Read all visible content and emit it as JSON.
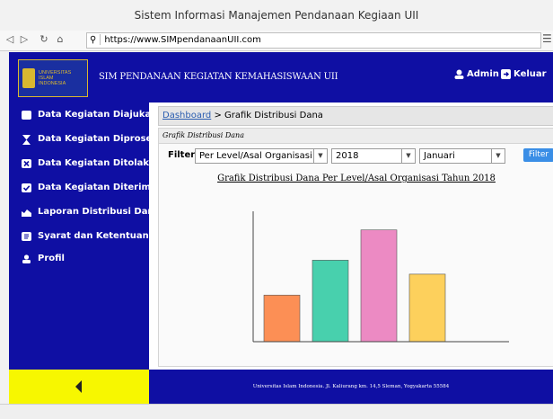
{
  "window": {
    "title": "Sistem Informasi Manajemen Pendanaan Kegiaan UII"
  },
  "browser": {
    "url": "https://www.SIMpendanaanUII.com",
    "nav_icons": [
      "back-icon",
      "forward-icon",
      "refresh-icon",
      "home-icon",
      "search-icon",
      "menu-icon"
    ]
  },
  "header": {
    "logo_lines": [
      "UNIVERSITAS",
      "ISLAM",
      "INDONESIA"
    ],
    "site_name": "SIM PENDANAAN KEGIATAN KEMAHASISWAAN UII",
    "admin_label": "Admin",
    "logout_label": "Keluar"
  },
  "sidebar": {
    "items": [
      {
        "label": "Data Kegiatan Diajukan",
        "icon": "folder-open-icon"
      },
      {
        "label": "Data Kegiatan Diproses",
        "icon": "hourglass-icon"
      },
      {
        "label": "Data Kegiatan Ditolak",
        "icon": "x-box-icon"
      },
      {
        "label": "Data Kegiatan Diterima",
        "icon": "checkbox-icon"
      },
      {
        "label": "Laporan Distribusi Dana",
        "icon": "area-chart-icon"
      },
      {
        "label": "Syarat dan Ketentuan",
        "icon": "document-icon"
      },
      {
        "label": "Profil",
        "icon": "user-icon"
      }
    ]
  },
  "breadcrumb": {
    "home": "Dashboard",
    "separator": " > ",
    "current": "Grafik Distribusi Dana"
  },
  "panel": {
    "title": "Grafik Distribusi Dana",
    "filter_label": "Filter",
    "select_level": "Per Level/Asal Organisasi",
    "select_year": "2018",
    "select_month": "Januari",
    "filter_button": "Filter"
  },
  "chart_data": {
    "type": "bar",
    "title": "Grafik Distribusi Dana Per Level/Asal Organisasi Tahun 2018",
    "xlabel": "",
    "ylabel": "",
    "categories": [
      "",
      "",
      "",
      ""
    ],
    "values": [
      1.0,
      1.75,
      2.4,
      1.45
    ],
    "colors": [
      "#fc8f55",
      "#48d0ad",
      "#ec8ac3",
      "#fdd05c"
    ],
    "ylim": [
      0,
      2.8
    ],
    "grid": false
  },
  "footer": {
    "text": "Universitas Islam Indonesia. Jl. Kaliurang km. 14,5 Sleman, Yogyakarta 55584"
  },
  "collapse_icon": "chevron-left-icon"
}
